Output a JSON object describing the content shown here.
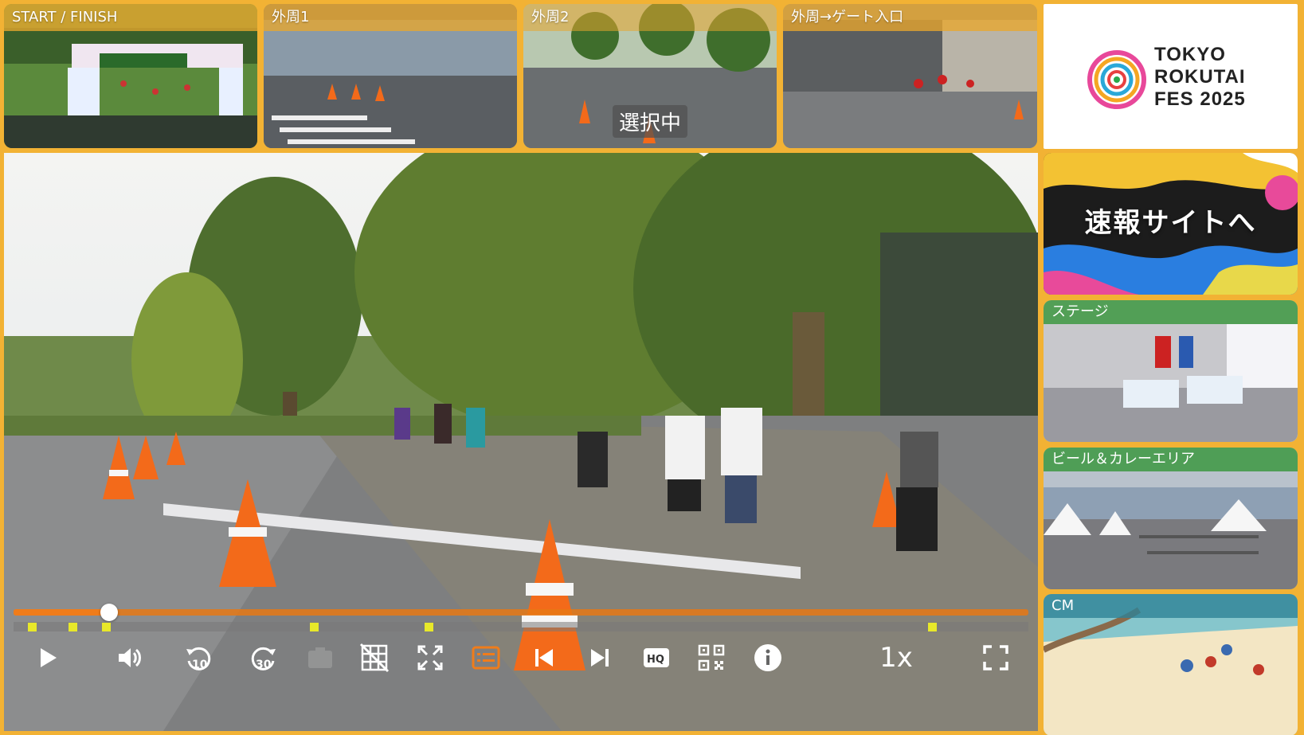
{
  "top_thumbnails": [
    {
      "label": "START / FINISH",
      "selected": false
    },
    {
      "label": "外周1",
      "selected": false
    },
    {
      "label": "外周2",
      "selected": true,
      "badge": "選択中"
    },
    {
      "label": "外周→ゲート入口",
      "selected": false
    }
  ],
  "logo": {
    "lines": [
      "TOKYO",
      "ROKUTAI",
      "FES 2025"
    ]
  },
  "promo": {
    "label": "速報サイトへ"
  },
  "side_thumbnails": [
    {
      "label": "ステージ"
    },
    {
      "label": "ビール＆カレーエリア"
    },
    {
      "label": "CM"
    }
  ],
  "player": {
    "progress_fraction": 0.094,
    "speed_label": "1x",
    "marker_fractions": [
      0.014,
      0.054,
      0.087,
      0.292,
      0.405,
      0.901
    ],
    "controls": [
      {
        "name": "play-icon",
        "enabled": true
      },
      {
        "name": "volume-icon",
        "enabled": true
      },
      {
        "name": "rewind-10-icon",
        "enabled": true
      },
      {
        "name": "forward-30-icon",
        "enabled": true
      },
      {
        "name": "camera-icon",
        "enabled": false
      },
      {
        "name": "grid-off-icon",
        "enabled": true
      },
      {
        "name": "zoom-out-icon",
        "enabled": true
      },
      {
        "name": "chapters-icon",
        "enabled": true,
        "active": true
      },
      {
        "name": "skip-previous-icon",
        "enabled": true
      },
      {
        "name": "skip-next-icon",
        "enabled": true
      },
      {
        "name": "hq-icon",
        "enabled": true
      },
      {
        "name": "qr-code-icon",
        "enabled": true
      },
      {
        "name": "info-icon",
        "enabled": true
      },
      {
        "name": "fullscreen-icon",
        "enabled": true
      }
    ]
  },
  "colors": {
    "frame": "#f2b234",
    "accent_orange": "#f07c1a",
    "marker_yellow": "#e8e82a",
    "side_label_green": "#38963c"
  }
}
